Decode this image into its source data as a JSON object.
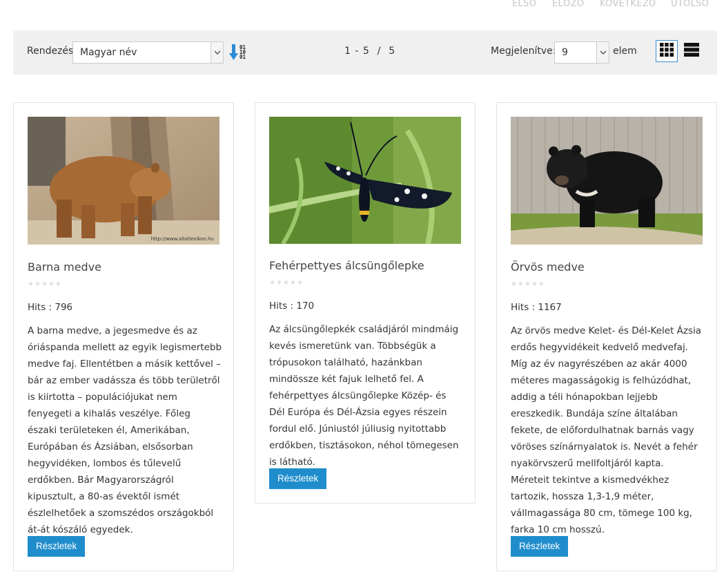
{
  "pagination": {
    "first": "ELSŐ",
    "prev": "ELŐZŐ",
    "next": "KÖVETKEZŐ",
    "last": "UTOLSÓ"
  },
  "toolbar": {
    "sort_label": "Rendezés",
    "sort_value": "Magyar név",
    "count_text": "1 - 5  /  5",
    "display_label": "Megjelenítve:",
    "display_value": "9",
    "display_suffix": "elem"
  },
  "cards": [
    {
      "title": "Barna medve",
      "hits": "Hits : 796",
      "image_icon": "brown-bear-photo",
      "watermark": "http://www.allatlexikon.hu",
      "description": "A barna medve, a jegesmedve és az óriáspanda mellett az egyik legismertebb medve faj. Ellentétben a másik kettővel – bár az ember vadássza és több területről is kiirtotta – populációjukat nem fenyegeti a kihalás veszélye. Főleg északi területeken él, Amerikában, Európában és Ázsiában, elsősorban hegyvidéken, lombos és tűlevelű erdőkben. Bár Magyarországról kipusztult, a 80-as évektől ismét észlelhetőek a szomszédos országokból át-át kószáló egyedek.",
      "button": "Részletek"
    },
    {
      "title": "Fehérpettyes álcsüngőlepke",
      "hits": "Hits : 170",
      "image_icon": "moth-photo",
      "description": "Az álcsüngőlepkék családjáról mindmáig kevés ismeretünk van. Többségük a trópusokon található, hazánkban mindössze két fajuk lelhető fel. A fehérpettyes álcsüngőlepke Közép- és Dél Európa és Dél-Ázsia egyes részein fordul elő. Júniustól júliusig nyitottabb erdőkben, tisztásokon, néhol tömegesen is látható.",
      "button": "Részletek"
    },
    {
      "title": "Örvös medve",
      "hits": "Hits : 1167",
      "image_icon": "black-bear-photo",
      "description": "Az örvös medve Kelet- és Dél-Kelet Ázsia erdős hegyvidékeit kedvelő medvefaj. Míg az év nagyrészében az akár 4000 méteres magasságokig is felhúzódhat, addig a téli hónapokban lejjebb ereszkedik. Bundája színe általában fekete, de előfordulhatnak barnás vagy vöröses színárnyalatok is. Nevét a fehér nyakörvszerű mellfoltjáról kapta. Méreteit tekintve a kismedvékhez tartozik, hossza 1,3-1,9 méter, vállmagassága 80 cm, tömege 100 kg, farka 10 cm hosszú.",
      "button": "Részletek"
    }
  ],
  "colors": {
    "accent": "#1f8dcc",
    "toolbar_bg": "#f0f0f0",
    "pagination_text": "#c6c6c6"
  }
}
